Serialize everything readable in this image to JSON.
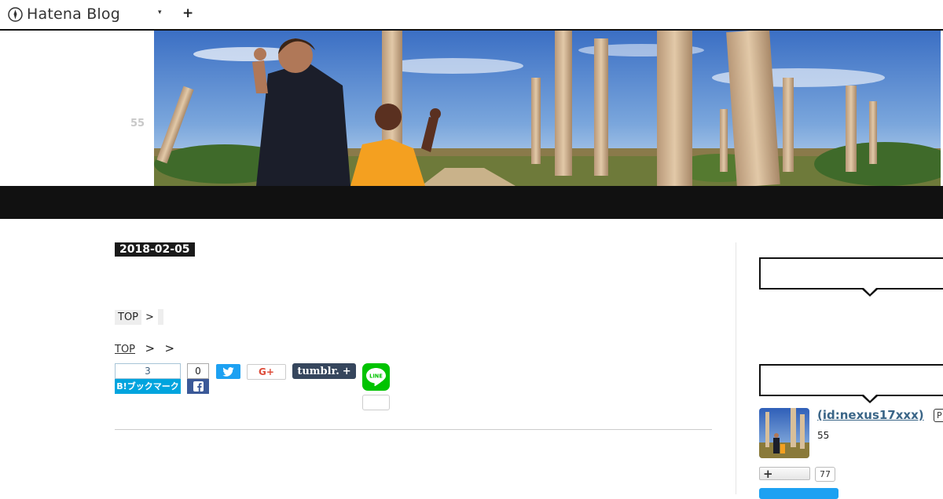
{
  "topbar": {
    "logo_text": "Hatena Blog",
    "caret_icon": "▾",
    "plus_label": "+"
  },
  "header": {
    "count": "55"
  },
  "article": {
    "date": "2018-02-05",
    "breadcrumb1": {
      "top": "TOP",
      "sep": ">"
    },
    "breadcrumb2": {
      "top": "TOP",
      "sep1": ">",
      "sep2": ">"
    },
    "share": {
      "hatena_count": "3",
      "hatena_label": "B!ブックマーク",
      "facebook_count": "0",
      "google_label": "G+",
      "tumblr_label": "tumblr.",
      "tumblr_plus": "+",
      "line_label": "LINE"
    }
  },
  "sidebar": {
    "author_id": " (id:nexus17xxx)",
    "pro_badge": "P",
    "author_count": "55",
    "follow_plus": "+",
    "follow_count": "77"
  },
  "colors": {
    "hatena_blue": "#00a4de",
    "facebook": "#3b5998",
    "twitter": "#1da1f2",
    "tumblr": "#36465d",
    "line": "#00c300",
    "dark": "#111111"
  }
}
